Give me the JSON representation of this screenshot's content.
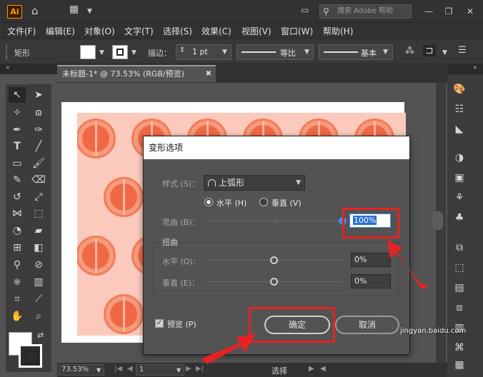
{
  "app": {
    "logo_text": "Ai",
    "search_placeholder": "搜索 Adobe 帮助"
  },
  "menu": [
    "文件(F)",
    "编辑(E)",
    "对象(O)",
    "文字(T)",
    "选择(S)",
    "效果(C)",
    "视图(V)",
    "窗口(W)",
    "帮助(H)"
  ],
  "control_bar": {
    "object_label": "矩形",
    "stroke_label": "描边：",
    "stroke_value": "1 pt",
    "profile_label": "等比",
    "brush_label": "基本"
  },
  "document": {
    "tab_title": "未标题-1* @ 73.53% (RGB/预览)",
    "zoom": "73.53%",
    "page": "1",
    "status_text": "选择"
  },
  "dialog": {
    "title": "变形选项",
    "style_label": "样式 (S)：",
    "style_value": "上弧形",
    "horizontal_label": "水平 (H)",
    "vertical_label": "垂直 (V)",
    "orientation_selected": "horizontal",
    "bend_label": "弯曲 (B)：",
    "bend_value": "100%",
    "bend_percent": 100,
    "distortion_title": "扭曲",
    "dist_h_label": "水平 (O)：",
    "dist_h_value": "0%",
    "dist_h_percent": 0,
    "dist_v_label": "垂直 (E)：",
    "dist_v_value": "0%",
    "dist_v_percent": 0,
    "preview_label": "预览 (P)",
    "preview_checked": true,
    "ok_label": "确定",
    "cancel_label": "取消"
  },
  "watermark": "jingyan.baidu.com",
  "colors": {
    "accent_blue": "#3b8fe6",
    "annotation_red": "#e82222",
    "artwork_bg": "#fccabd",
    "orange": "#f06944"
  }
}
